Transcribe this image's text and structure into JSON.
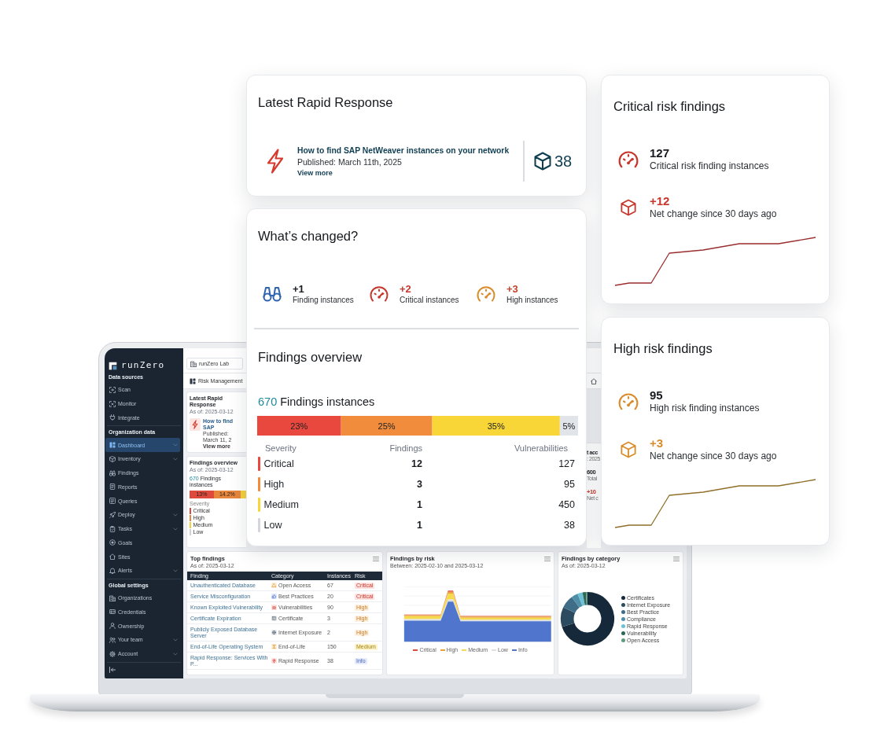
{
  "rapid_response": {
    "title": "Latest Rapid Response",
    "link": "How to find SAP NetWeaver instances on your network",
    "published": "Published: March 11th, 2025",
    "more": "View more",
    "count": "38"
  },
  "whats_changed": {
    "title": "What’s changed?",
    "stats": [
      {
        "value": "+1",
        "label": "Finding instances",
        "kind": "all"
      },
      {
        "value": "+2",
        "label": "Critical instances",
        "kind": "critical"
      },
      {
        "value": "+3",
        "label": "High instances",
        "kind": "high"
      }
    ]
  },
  "findings_overview": {
    "title": "Findings overview",
    "count": "670",
    "count_label": "Findings instances",
    "chart_data": {
      "type": "bar",
      "orientation": "horizontal",
      "stacked": true,
      "categories": [
        null
      ],
      "series": [
        {
          "color": "#e8483d",
          "values": [
            23
          ],
          "value_labels": [
            "23%"
          ]
        },
        {
          "color": "#f08c3c",
          "values": [
            25
          ],
          "value_labels": [
            "25%"
          ]
        },
        {
          "color": "#f8d637",
          "values": [
            35
          ],
          "value_labels": [
            "35%"
          ]
        },
        {
          "color": "#e1e4e9",
          "values": [
            5
          ],
          "value_labels": [
            "5%"
          ]
        }
      ]
    },
    "columns": [
      "Severity",
      "Findings",
      "Vulnerabilities"
    ],
    "rows": [
      {
        "label": "Critical",
        "findings": "12",
        "vulnerabilities": "127",
        "color": "#e8483d"
      },
      {
        "label": "High",
        "findings": "3",
        "vulnerabilities": "95",
        "color": "#f08c3c"
      },
      {
        "label": "Medium",
        "findings": "1",
        "vulnerabilities": "450",
        "color": "#f8d637"
      },
      {
        "label": "Low",
        "findings": "1",
        "vulnerabilities": "38",
        "color": "#d3d7dd"
      }
    ]
  },
  "risk_cards": [
    {
      "kind": "critical",
      "title": "Critical risk findings",
      "total": "127",
      "total_label": "Critical risk finding instances",
      "change": "+12",
      "change_label": "Net change since 30 days ago"
    },
    {
      "kind": "high",
      "title": "High risk findings",
      "total": "95",
      "total_label": "High risk finding instances",
      "change": "+3",
      "change_label": "Net change since 30 days ago"
    }
  ],
  "laptop": {
    "sidebar": {
      "logo": "runZero",
      "sections": [
        {
          "title": "Data sources",
          "items": [
            {
              "label": "Scan",
              "kind": "link",
              "selected": false
            },
            {
              "label": "Monitor",
              "kind": "link",
              "selected": false
            },
            {
              "label": "Integrate",
              "kind": "link",
              "selected": false
            }
          ]
        },
        {
          "title": "Organization data",
          "items": [
            {
              "label": "Dashboard",
              "kind": "group",
              "selected": true
            },
            {
              "label": "Inventory",
              "kind": "group",
              "selected": false
            },
            {
              "label": "Findings",
              "kind": "link",
              "selected": false
            },
            {
              "label": "Reports",
              "kind": "link",
              "selected": false
            },
            {
              "label": "Queries",
              "kind": "link",
              "selected": false
            },
            {
              "label": "Deploy",
              "kind": "group",
              "selected": false
            },
            {
              "label": "Tasks",
              "kind": "group",
              "selected": false
            },
            {
              "label": "Goals",
              "kind": "link",
              "selected": false
            },
            {
              "label": "Sites",
              "kind": "link",
              "selected": false
            },
            {
              "label": "Alerts",
              "kind": "group",
              "selected": false
            }
          ]
        },
        {
          "title": "Global settings",
          "items": [
            {
              "label": "Organizations",
              "kind": "link",
              "selected": false
            },
            {
              "label": "Credentials",
              "kind": "link",
              "selected": false
            },
            {
              "label": "Ownership",
              "kind": "link",
              "selected": false
            },
            {
              "label": "Your team",
              "kind": "group",
              "selected": false
            },
            {
              "label": "Account",
              "kind": "group",
              "selected": false
            }
          ]
        }
      ]
    },
    "header": {
      "workspace": "runZero Lab",
      "page": "Risk Management"
    },
    "rapid_response": {
      "title": "Latest Rapid Response",
      "date": "As of: 2025-03-12",
      "link": "How to find SAP",
      "published": "Published: March 11, 2",
      "more": "View more"
    },
    "findings_overview": {
      "title": "Findings overview",
      "date": "As of: 2025-03-12",
      "count": "670",
      "count_label": "Findings instances",
      "bar_segments": [
        {
          "label": "13%",
          "color": "#de4a3c"
        },
        {
          "label": "14.2%",
          "color": "#e8873c"
        },
        {
          "color": "#f3d03c"
        }
      ],
      "severity_label": "Severity",
      "rows": [
        {
          "label": "Critical",
          "color": "#de4a3c"
        },
        {
          "label": "High",
          "color": "#e8873c"
        },
        {
          "label": "Medium",
          "color": "#f3d03c"
        },
        {
          "label": "Low",
          "color": "#cfd3d9"
        }
      ]
    },
    "summary_card": {
      "title": "t acc",
      "date": ": 2025",
      "total": "600",
      "total_label": "Total",
      "change": "+10",
      "change_label": "Net c"
    },
    "top_findings": {
      "title": "Top findings",
      "date": "As of: 2025-03-12",
      "columns": [
        "Finding",
        "Category",
        "Instances",
        "Risk"
      ],
      "rows": [
        {
          "finding": "Unauthenticated Database",
          "category": {
            "label": "Open Access",
            "kind": "open-access"
          },
          "instances": "67",
          "risk": {
            "label": "Critical",
            "kind": "critical"
          }
        },
        {
          "finding": "Service Misconfiguration",
          "category": {
            "label": "Best Practices",
            "kind": "best-practices"
          },
          "instances": "20",
          "risk": {
            "label": "Critical",
            "kind": "critical"
          }
        },
        {
          "finding": "Known Exploited Vulnerability",
          "category": {
            "label": "Vulnerabilities",
            "kind": "vulnerabilities"
          },
          "instances": "90",
          "risk": {
            "label": "High",
            "kind": "high"
          }
        },
        {
          "finding": "Certificate Expiration",
          "category": {
            "label": "Certificate",
            "kind": "certificate"
          },
          "instances": "3",
          "risk": {
            "label": "High",
            "kind": "high"
          }
        },
        {
          "finding": "Publicly Exposed Database Server",
          "category": {
            "label": "Internet Exposure",
            "kind": "internet-exposure"
          },
          "instances": "2",
          "risk": {
            "label": "High",
            "kind": "high"
          }
        },
        {
          "finding": "End-of-Life Operating System",
          "category": {
            "label": "End-of-Life",
            "kind": "end-of-life"
          },
          "instances": "150",
          "risk": {
            "label": "Medium",
            "kind": "medium"
          }
        },
        {
          "finding": "Rapid Response: Services With P...",
          "category": {
            "label": "Rapid Response",
            "kind": "rapid-response"
          },
          "instances": "38",
          "risk": {
            "label": "Info",
            "kind": "info"
          }
        }
      ]
    },
    "findings_by_risk": {
      "title": "Findings by risk",
      "date": "Between: 2025-02-10 and 2025-03-12",
      "legend": [
        {
          "label": "Critical",
          "color": "#e0473a"
        },
        {
          "label": "High",
          "color": "#eba23b"
        },
        {
          "label": "Medium",
          "color": "#f6da4e"
        },
        {
          "label": "Low",
          "color": "#dcdfe4"
        },
        {
          "label": "Info",
          "color": "#4f76cc"
        }
      ]
    },
    "findings_by_category": {
      "title": "Findings by category",
      "date": "As of: 2025-03-12",
      "categories": [
        {
          "label": "Certificates",
          "color": "#15293b"
        },
        {
          "label": "Internet Exposure",
          "color": "#2c4b60"
        },
        {
          "label": "Best Practice",
          "color": "#3f6d88"
        },
        {
          "label": "Compliance",
          "color": "#4f8fa8"
        },
        {
          "label": "Rapid Response",
          "color": "#6cc2d4"
        },
        {
          "label": "Vulnerability",
          "color": "#2e6657"
        },
        {
          "label": "Open Access",
          "color": "#5d9c80"
        }
      ]
    }
  }
}
